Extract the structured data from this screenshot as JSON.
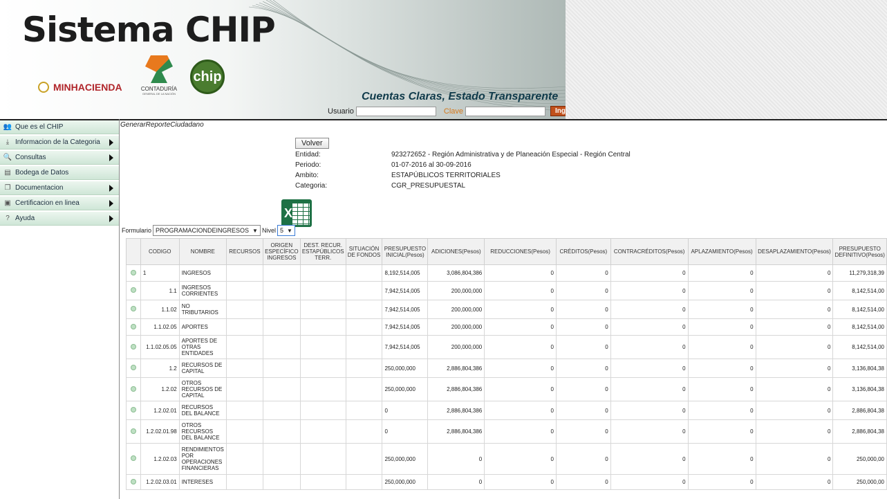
{
  "banner": {
    "title": "Sistema CHIP",
    "minhacienda": "MINHACIENDA",
    "contaduria_name": "CONTADURÍA",
    "contaduria_sub": "GENERAL DE LA NACIÓN",
    "chip_logo": "chip",
    "slogan": "Cuentas Claras, Estado Transparente",
    "usuario_label": "Usuario",
    "clave_label": "Clave",
    "ingresar_label": "Ingresar"
  },
  "sidebar": {
    "items": [
      {
        "label": "Que es el CHIP",
        "icon": "people-icon",
        "has_arrow": false
      },
      {
        "label": "Informacion de la Categoria",
        "icon": "download-icon",
        "has_arrow": true
      },
      {
        "label": "Consultas",
        "icon": "search-icon",
        "has_arrow": true
      },
      {
        "label": "Bodega de Datos",
        "icon": "database-icon",
        "has_arrow": false
      },
      {
        "label": "Documentacion",
        "icon": "document-icon",
        "has_arrow": true
      },
      {
        "label": "Certificacion en linea",
        "icon": "certificate-icon",
        "has_arrow": true
      },
      {
        "label": "Ayuda",
        "icon": "help-icon",
        "has_arrow": true
      }
    ]
  },
  "page": {
    "breadcrumb": "GenerarReporteCiudadano",
    "volver_label": "Volver"
  },
  "info": {
    "entidad_label": "Entidad:",
    "entidad_value": "923272652 - Región Administrativa y de Planeación Especial - Región Central",
    "periodo_label": "Periodo:",
    "periodo_value": "01-07-2016 al 30-09-2016",
    "ambito_label": "Ambito:",
    "ambito_value": "ESTAPÚBLICOS TERRITORIALES",
    "categoria_label": "Categoria:",
    "categoria_value": "CGR_PRESUPUESTAL"
  },
  "filters": {
    "formulario_label": "Formulario",
    "formulario_value": "PROGRAMACIONDEINGRESOS",
    "nivel_label": "Nivel",
    "nivel_value": "5"
  },
  "table": {
    "headers": [
      "CODIGO",
      "NOMBRE",
      "RECURSOS",
      "ORIGEN ESPECÍFICO INGRESOS",
      "DEST. RECUR. ESTAPÚBLICOS TERR.",
      "SITUACIÓN DE FONDOS",
      "PRESUPUESTO INICIAL(Pesos)",
      "ADICIONES(Pesos)",
      "REDUCCIONES(Pesos)",
      "CRÉDITOS(Pesos)",
      "CONTRACRÉDITOS(Pesos)",
      "APLAZAMIENTO(Pesos)",
      "DESAPLAZAMIENTO(Pesos)",
      "PRESUPUESTO DEFINITIVO(Pesos)"
    ],
    "rows": [
      {
        "codigo": "1",
        "nombre": "INGRESOS",
        "recursos": "",
        "origen": "",
        "dest": "",
        "situacion": "",
        "inicial": "8,192,514,005",
        "adiciones": "3,086,804,386",
        "reducciones": "0",
        "creditos": "0",
        "contracreditos": "0",
        "aplazamiento": "0",
        "desaplazamiento": "0",
        "definitivo": "11,279,318,39"
      },
      {
        "codigo": "1.1",
        "nombre": "INGRESOS CORRIENTES",
        "recursos": "",
        "origen": "",
        "dest": "",
        "situacion": "",
        "inicial": "7,942,514,005",
        "adiciones": "200,000,000",
        "reducciones": "0",
        "creditos": "0",
        "contracreditos": "0",
        "aplazamiento": "0",
        "desaplazamiento": "0",
        "definitivo": "8,142,514,00"
      },
      {
        "codigo": "1.1.02",
        "nombre": "NO TRIBUTARIOS",
        "recursos": "",
        "origen": "",
        "dest": "",
        "situacion": "",
        "inicial": "7,942,514,005",
        "adiciones": "200,000,000",
        "reducciones": "0",
        "creditos": "0",
        "contracreditos": "0",
        "aplazamiento": "0",
        "desaplazamiento": "0",
        "definitivo": "8,142,514,00"
      },
      {
        "codigo": "1.1.02.05",
        "nombre": "APORTES",
        "recursos": "",
        "origen": "",
        "dest": "",
        "situacion": "",
        "inicial": "7,942,514,005",
        "adiciones": "200,000,000",
        "reducciones": "0",
        "creditos": "0",
        "contracreditos": "0",
        "aplazamiento": "0",
        "desaplazamiento": "0",
        "definitivo": "8,142,514,00"
      },
      {
        "codigo": "1.1.02.05.05",
        "nombre": "APORTES DE OTRAS ENTIDADES",
        "recursos": "",
        "origen": "",
        "dest": "",
        "situacion": "",
        "inicial": "7,942,514,005",
        "adiciones": "200,000,000",
        "reducciones": "0",
        "creditos": "0",
        "contracreditos": "0",
        "aplazamiento": "0",
        "desaplazamiento": "0",
        "definitivo": "8,142,514,00"
      },
      {
        "codigo": "1.2",
        "nombre": "RECURSOS DE CAPITAL",
        "recursos": "",
        "origen": "",
        "dest": "",
        "situacion": "",
        "inicial": "250,000,000",
        "adiciones": "2,886,804,386",
        "reducciones": "0",
        "creditos": "0",
        "contracreditos": "0",
        "aplazamiento": "0",
        "desaplazamiento": "0",
        "definitivo": "3,136,804,38"
      },
      {
        "codigo": "1.2.02",
        "nombre": "OTROS RECURSOS DE CAPITAL",
        "recursos": "",
        "origen": "",
        "dest": "",
        "situacion": "",
        "inicial": "250,000,000",
        "adiciones": "2,886,804,386",
        "reducciones": "0",
        "creditos": "0",
        "contracreditos": "0",
        "aplazamiento": "0",
        "desaplazamiento": "0",
        "definitivo": "3,136,804,38"
      },
      {
        "codigo": "1.2.02.01",
        "nombre": "RECURSOS DEL BALANCE",
        "recursos": "",
        "origen": "",
        "dest": "",
        "situacion": "",
        "inicial": "0",
        "adiciones": "2,886,804,386",
        "reducciones": "0",
        "creditos": "0",
        "contracreditos": "0",
        "aplazamiento": "0",
        "desaplazamiento": "0",
        "definitivo": "2,886,804,38"
      },
      {
        "codigo": "1.2.02.01.98",
        "nombre": "OTROS RECURSOS DEL BALANCE",
        "recursos": "",
        "origen": "",
        "dest": "",
        "situacion": "",
        "inicial": "0",
        "adiciones": "2,886,804,386",
        "reducciones": "0",
        "creditos": "0",
        "contracreditos": "0",
        "aplazamiento": "0",
        "desaplazamiento": "0",
        "definitivo": "2,886,804,38"
      },
      {
        "codigo": "1.2.02.03",
        "nombre": "RENDIMIENTOS POR OPERACIONES FINANCIERAS",
        "recursos": "",
        "origen": "",
        "dest": "",
        "situacion": "",
        "inicial": "250,000,000",
        "adiciones": "0",
        "reducciones": "0",
        "creditos": "0",
        "contracreditos": "0",
        "aplazamiento": "0",
        "desaplazamiento": "0",
        "definitivo": "250,000,00"
      },
      {
        "codigo": "1.2.02.03.01",
        "nombre": "INTERESES",
        "recursos": "",
        "origen": "",
        "dest": "",
        "situacion": "",
        "inicial": "250,000,000",
        "adiciones": "0",
        "reducciones": "0",
        "creditos": "0",
        "contracreditos": "0",
        "aplazamiento": "0",
        "desaplazamiento": "0",
        "definitivo": "250,000,00"
      }
    ]
  }
}
